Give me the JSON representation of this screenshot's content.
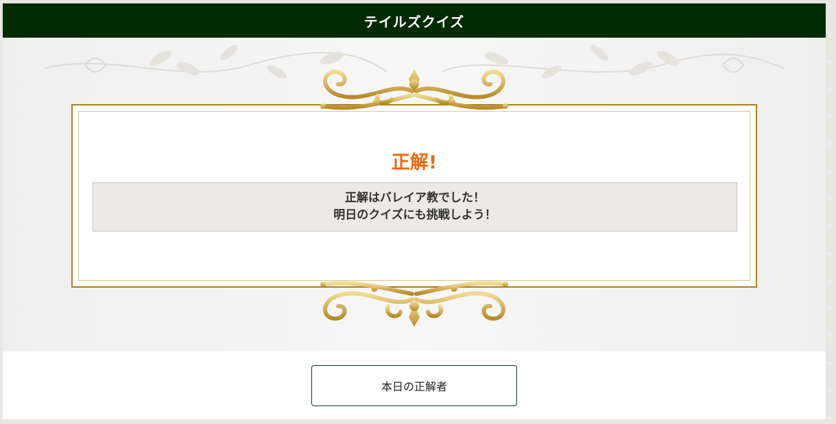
{
  "header": {
    "title": "テイルズクイズ"
  },
  "result": {
    "title": "正解!",
    "message_line1": "正解はバレイア教でした！",
    "message_line2": "明日のクイズにも挑戦しよう！"
  },
  "footer": {
    "winners_button_label": "本日の正解者"
  },
  "colors": {
    "header_bg": "#002a00",
    "accent_orange": "#ea6b12",
    "gold": "#c9a23c",
    "button_border": "#0e3a20"
  },
  "icons": {
    "top": "ornate-scroll-top-icon",
    "bottom": "ornate-scroll-bottom-icon",
    "vines": "vine-pattern-decoration"
  }
}
